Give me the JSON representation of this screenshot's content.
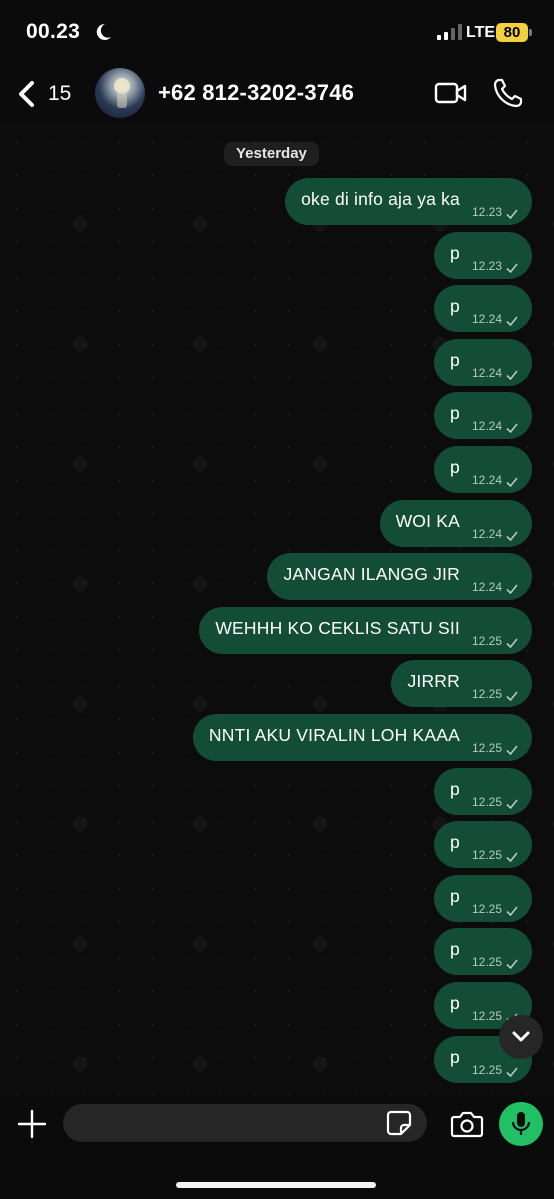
{
  "status_bar": {
    "time": "00.23",
    "network": "LTE",
    "battery": "80",
    "moon_icon": "moon-icon",
    "signal_icon": "signal-icon"
  },
  "header": {
    "back_count": "15",
    "contact_name": "+62 812-3202-3746",
    "icons": [
      "back-chevron-icon",
      "video-call-icon",
      "phone-call-icon"
    ]
  },
  "chat": {
    "date_label": "Yesterday",
    "accent_bubble": "#134d37",
    "messages": [
      {
        "text": "oke di info aja ya ka",
        "time": "12.23"
      },
      {
        "text": "p",
        "time": "12.23"
      },
      {
        "text": "p",
        "time": "12.24"
      },
      {
        "text": "p",
        "time": "12.24"
      },
      {
        "text": "p",
        "time": "12.24"
      },
      {
        "text": "p",
        "time": "12.24"
      },
      {
        "text": "WOI KA",
        "time": "12.24"
      },
      {
        "text": "JANGAN ILANGG JIR",
        "time": "12.24"
      },
      {
        "text": "WEHHH KO CEKLIS SATU SII",
        "time": "12.25"
      },
      {
        "text": "JIRRR",
        "time": "12.25"
      },
      {
        "text": "NNTI AKU VIRALIN LOH KAAA",
        "time": "12.25"
      },
      {
        "text": "p",
        "time": "12.25"
      },
      {
        "text": "p",
        "time": "12.25"
      },
      {
        "text": "p",
        "time": "12.25"
      },
      {
        "text": "p",
        "time": "12.25"
      },
      {
        "text": "p",
        "time": "12.25"
      },
      {
        "text": "p",
        "time": "12.25"
      }
    ]
  },
  "composer": {
    "input_value": "",
    "icons": [
      "plus-icon",
      "sticker-icon",
      "camera-icon",
      "microphone-icon"
    ],
    "mic_color": "#21c064"
  }
}
